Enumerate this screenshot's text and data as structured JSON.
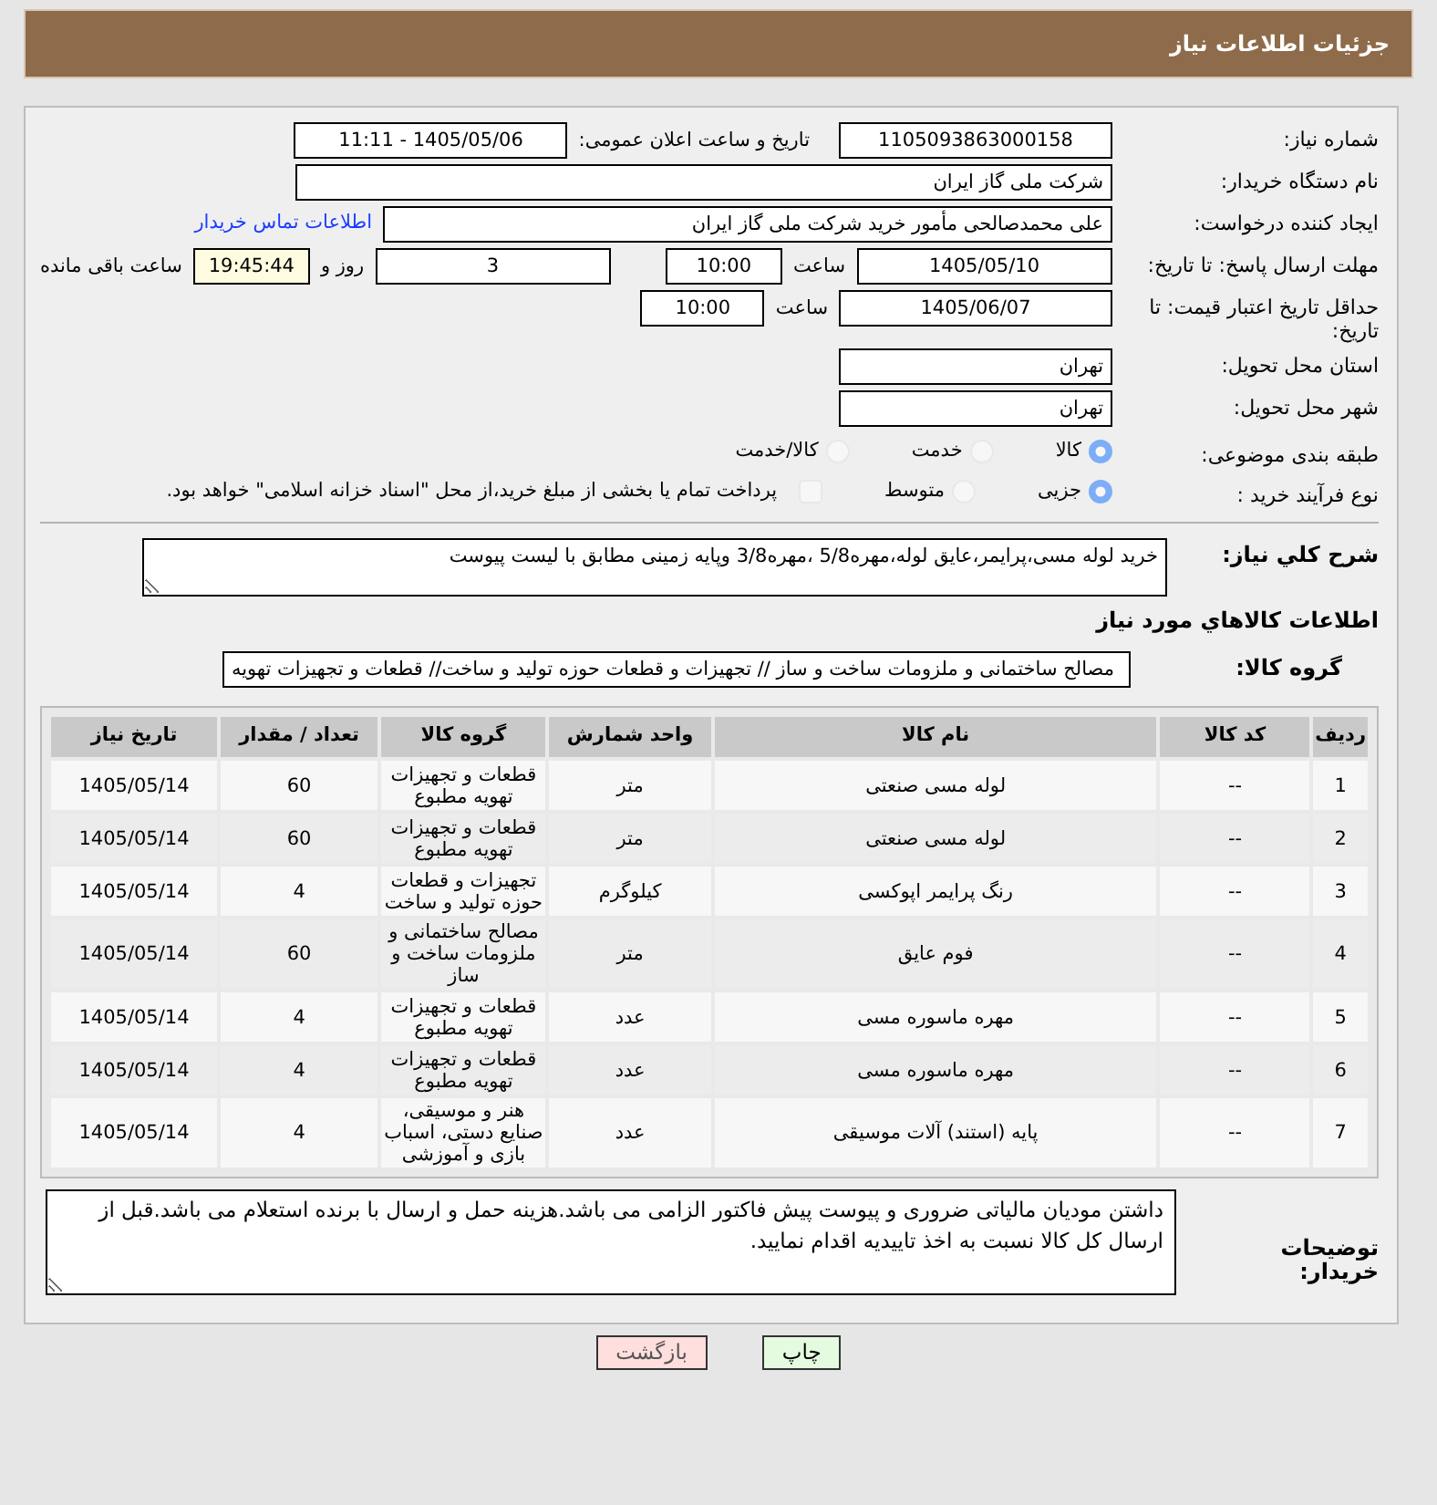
{
  "page_title": "جزئیات اطلاعات نیاز",
  "need_number": {
    "label": "شماره نیاز:",
    "value": "1105093863000158"
  },
  "announce_datetime": {
    "label": "تاریخ و ساعت اعلان عمومی:",
    "value": "1405/05/06 - 11:11"
  },
  "buyer_org": {
    "label": "نام دستگاه خریدار:",
    "value": "شرکت ملی گاز ایران"
  },
  "requester": {
    "label": "ایجاد کننده درخواست:",
    "value": "علی محمدصالحی مأمور خرید شرکت ملی گاز ایران",
    "link": "اطلاعات تماس خریدار"
  },
  "reply_deadline": {
    "label": "مهلت ارسال پاسخ: تا تاریخ:",
    "date": "1405/05/10",
    "time_label": "ساعت",
    "time": "10:00",
    "days": "3",
    "days_label": "روز و",
    "remaining": "19:45:44",
    "remaining_label": "ساعت باقی مانده"
  },
  "price_validity": {
    "label": "حداقل تاریخ اعتبار قیمت: تا تاریخ:",
    "date": "1405/06/07",
    "time_label": "ساعت",
    "time": "10:00"
  },
  "province": {
    "label": "استان محل تحویل:",
    "value": "تهران"
  },
  "city": {
    "label": "شهر محل تحویل:",
    "value": "تهران"
  },
  "category": {
    "label": "طبقه بندی موضوعی:",
    "options": [
      {
        "label": "کالا",
        "selected": true
      },
      {
        "label": "خدمت",
        "selected": false
      },
      {
        "label": "کالا/خدمت",
        "selected": false
      }
    ]
  },
  "purchase_process": {
    "label": "نوع فرآیند خرید :",
    "options": [
      {
        "label": "جزیی",
        "selected": true
      },
      {
        "label": "متوسط",
        "selected": false
      }
    ],
    "payment": {
      "label": "پرداخت تمام یا بخشی از مبلغ خرید،از محل \"اسناد خزانه اسلامی\" خواهد بود.",
      "checked": false
    }
  },
  "description": {
    "label": "شرح کلي نياز:",
    "value": "خرید لوله مسی،پرایمر،عایق لوله،مهره5/8 ،مهره3/8 وپایه زمینی مطابق با لیست پیوست"
  },
  "items_heading": "اطلاعات كالاهاي مورد نياز",
  "goods_group": {
    "label": "گروه كالا:",
    "value": "مصالح ساختمانی و ملزومات ساخت و ساز // تجهیزات و قطعات حوزه تولید و ساخت//  قطعات و تجهیزات تهویه"
  },
  "table": {
    "columns": [
      "ردیف",
      "کد کالا",
      "نام کالا",
      "واحد شمارش",
      "گروه کالا",
      "تعداد / مقدار",
      "تاریخ نیاز"
    ],
    "rows": [
      [
        "1",
        "--",
        "لوله مسی صنعتی",
        "متر",
        "قطعات و تجهیزات تهویه مطبوع",
        "60",
        "1405/05/14"
      ],
      [
        "2",
        "--",
        "لوله مسی صنعتی",
        "متر",
        "قطعات و تجهیزات تهویه مطبوع",
        "60",
        "1405/05/14"
      ],
      [
        "3",
        "--",
        "رنگ پرایمر اپوکسی",
        "کیلوگرم",
        "تجهیزات و قطعات حوزه تولید و ساخت",
        "4",
        "1405/05/14"
      ],
      [
        "4",
        "--",
        "فوم عایق",
        "متر",
        "مصالح ساختمانی و ملزومات ساخت و ساز",
        "60",
        "1405/05/14"
      ],
      [
        "5",
        "--",
        "مهره ماسوره مسی",
        "عدد",
        "قطعات و تجهیزات تهویه مطبوع",
        "4",
        "1405/05/14"
      ],
      [
        "6",
        "--",
        "مهره ماسوره مسی",
        "عدد",
        "قطعات و تجهیزات تهویه مطبوع",
        "4",
        "1405/05/14"
      ],
      [
        "7",
        "--",
        "پایه (استند) آلات موسیقی",
        "عدد",
        "هنر و موسیقی، صنایع دستی، اسباب بازی و آموزشی",
        "4",
        "1405/05/14"
      ]
    ]
  },
  "buyer_notes": {
    "label": "توضیحات خریدار:",
    "value": "داشتن مودیان مالیاتی ضروری و پیوست پیش فاکتور الزامی می باشد.هزینه حمل و ارسال با برنده استعلام می باشد.قبل از ارسال کل کالا نسبت به اخذ تاییدیه اقدام نمایید."
  },
  "buttons": [
    {
      "label": "چاپ",
      "kind": "print"
    },
    {
      "label": "بازگشت",
      "kind": "back"
    }
  ]
}
